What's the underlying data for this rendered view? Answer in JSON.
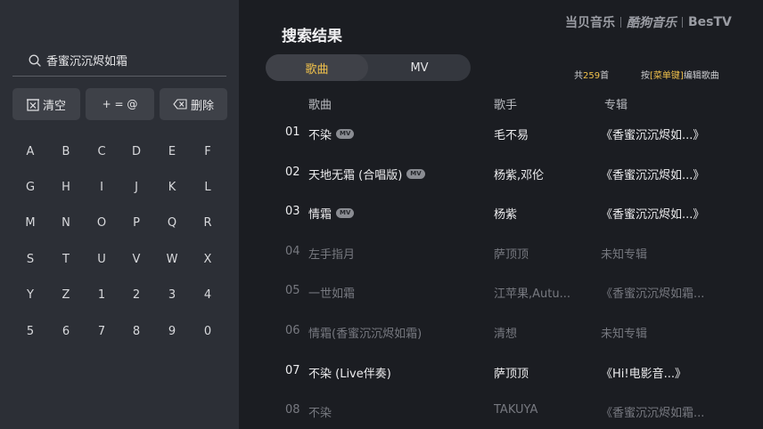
{
  "search": {
    "query": "香蜜沉沉烬如霜"
  },
  "actions": {
    "clear_label": "清空",
    "symbols_label": "+ = @",
    "delete_label": "删除"
  },
  "keyboard": {
    "rows": [
      [
        "A",
        "B",
        "C",
        "D",
        "E",
        "F"
      ],
      [
        "G",
        "H",
        "I",
        "J",
        "K",
        "L"
      ],
      [
        "M",
        "N",
        "O",
        "P",
        "Q",
        "R"
      ],
      [
        "S",
        "T",
        "U",
        "V",
        "W",
        "X"
      ],
      [
        "Y",
        "Z",
        "1",
        "2",
        "3",
        "4"
      ],
      [
        "5",
        "6",
        "7",
        "8",
        "9",
        "0"
      ]
    ]
  },
  "brand": {
    "logo1": "当贝音乐",
    "logo2": "酷狗音乐",
    "logo3": "BesTV"
  },
  "header": {
    "title": "搜索结果"
  },
  "tabs": [
    {
      "label": "歌曲",
      "active": true
    },
    {
      "label": "MV",
      "active": false
    }
  ],
  "count": {
    "prefix": "共",
    "value": "259",
    "suffix": "首"
  },
  "hint": {
    "prefix": "按",
    "key": "[菜单键]",
    "suffix": "编辑歌曲"
  },
  "columns": {
    "song": "歌曲",
    "artist": "歌手",
    "album": "专辑"
  },
  "mv_badge_label": "MV",
  "songs": [
    {
      "num": "01",
      "title": "不染",
      "mv": true,
      "artist": "毛不易",
      "album": "《香蜜沉沉烬如...》",
      "available": true
    },
    {
      "num": "02",
      "title": "天地无霜 (合唱版)",
      "mv": true,
      "artist": "杨紫,邓伦",
      "album": "《香蜜沉沉烬如...》",
      "available": true
    },
    {
      "num": "03",
      "title": "情霜",
      "mv": true,
      "artist": "杨紫",
      "album": "《香蜜沉沉烬如...》",
      "available": true
    },
    {
      "num": "04",
      "title": "左手指月",
      "mv": false,
      "artist": "萨顶顶",
      "album": "未知专辑",
      "available": false
    },
    {
      "num": "05",
      "title": "一世如霜",
      "mv": false,
      "artist": "江苹果,Autu...",
      "album": "《香蜜沉沉烬如霜...",
      "available": false
    },
    {
      "num": "06",
      "title": "情霜(香蜜沉沉烬如霜)",
      "mv": false,
      "artist": "清想",
      "album": "未知专辑",
      "available": false
    },
    {
      "num": "07",
      "title": "不染 (Live伴奏)",
      "mv": false,
      "artist": "萨顶顶",
      "album": "《Hi!电影音...》",
      "available": true
    },
    {
      "num": "08",
      "title": "不染",
      "mv": false,
      "artist": "TAKUYA",
      "album": "《香蜜沉沉烬如霜...",
      "available": false
    }
  ]
}
